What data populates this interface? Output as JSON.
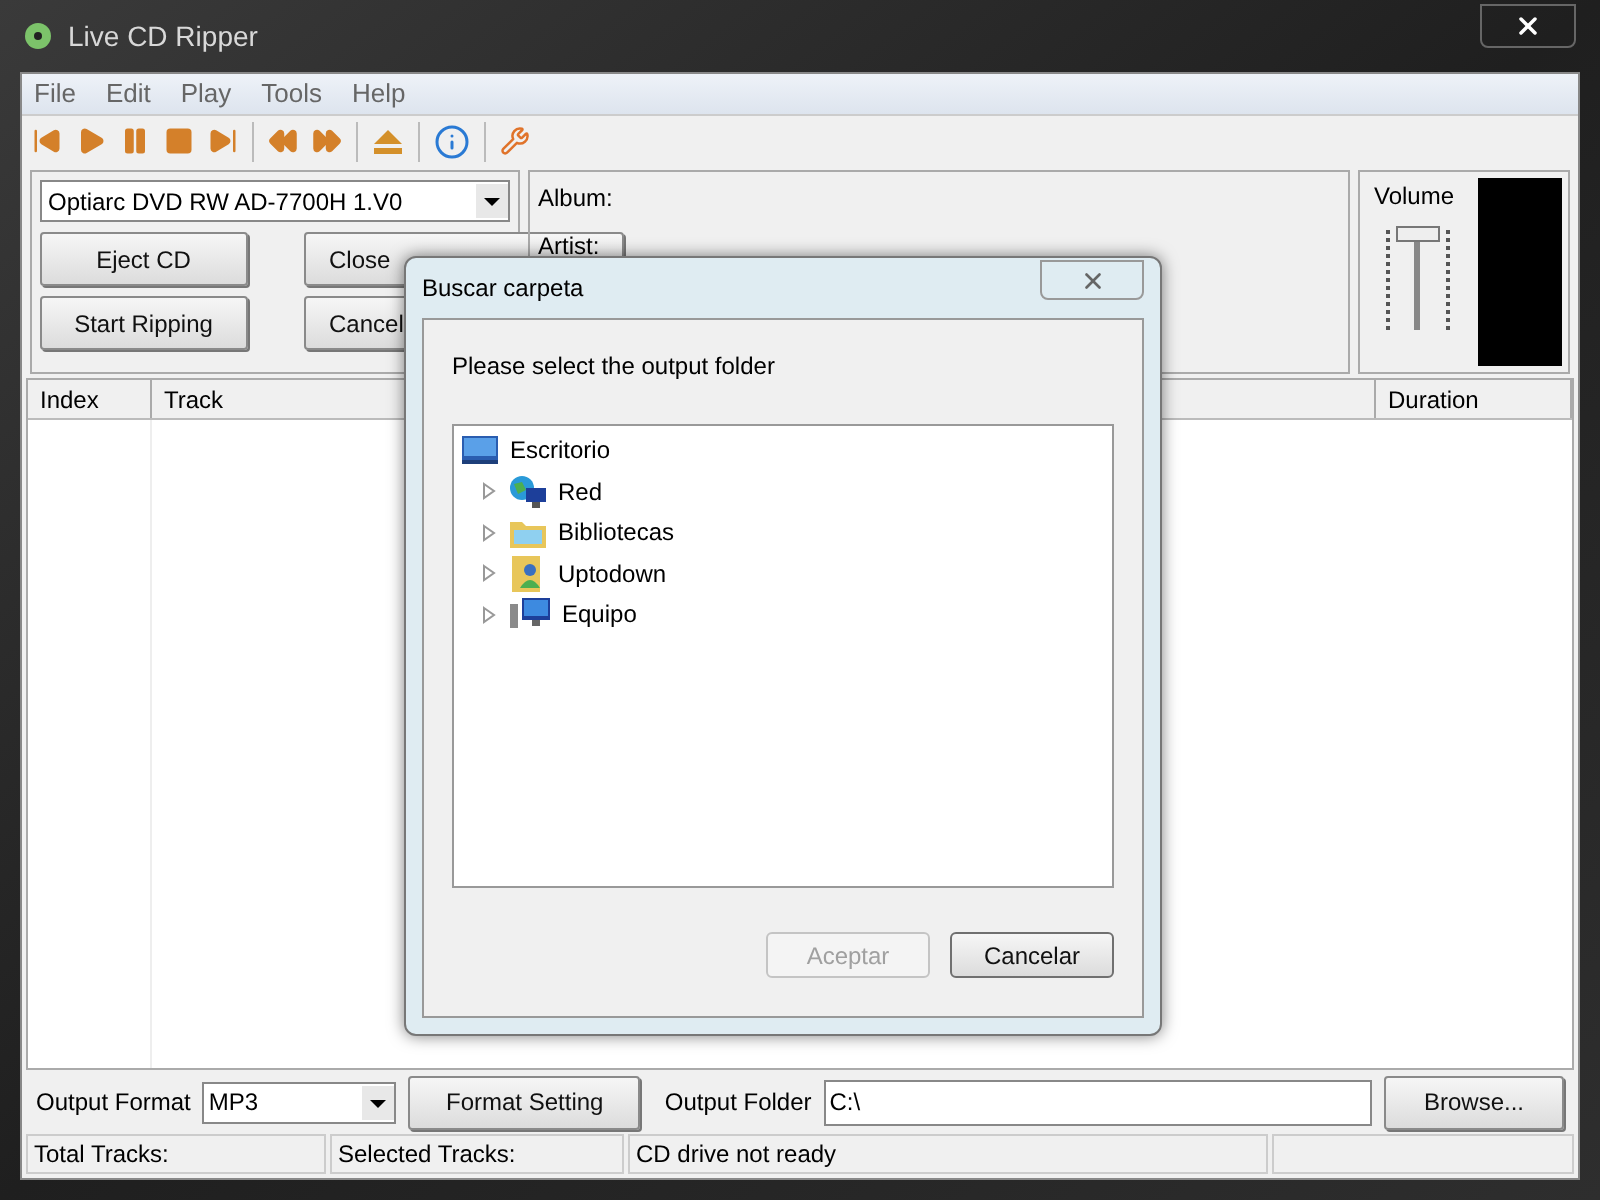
{
  "window": {
    "title": "Live CD Ripper"
  },
  "menu": [
    "File",
    "Edit",
    "Play",
    "Tools",
    "Help"
  ],
  "drive": {
    "value": "Optiarc DVD RW AD-7700H 1.V0"
  },
  "buttons": [
    "Eject CD",
    "Close",
    "Start Ripping",
    "Cancel"
  ],
  "info": [
    "Album:",
    "Artist:"
  ],
  "volume": {
    "label": "Volume",
    "level": 0.92
  },
  "table": {
    "columns": [
      "Index",
      "Track",
      "Duration"
    ]
  },
  "bottom": {
    "format_label": "Output Format",
    "format_value": "MP3",
    "format_button": "Format Setting",
    "folder_label": "Output Folder",
    "folder_value": "C:\\",
    "browse_button": "Browse..."
  },
  "status_bar": [
    "Total Tracks:",
    "Selected Tracks:",
    "CD drive not ready"
  ],
  "dialog": {
    "title": "Buscar carpeta",
    "prompt": "Please select the output folder",
    "tree": [
      {
        "label": "Escritorio",
        "kind": "desktop",
        "children": [
          {
            "label": "Red",
            "kind": "network",
            "expanded": false
          },
          {
            "label": "Bibliotecas",
            "kind": "library",
            "expanded": false
          },
          {
            "label": "Uptodown",
            "kind": "user",
            "expanded": false
          },
          {
            "label": "Equipo",
            "kind": "computer",
            "expanded": false
          }
        ]
      }
    ],
    "buttons": [
      {
        "label": "Aceptar",
        "disabled": true
      },
      {
        "label": "Cancelar",
        "disabled": false
      }
    ]
  }
}
